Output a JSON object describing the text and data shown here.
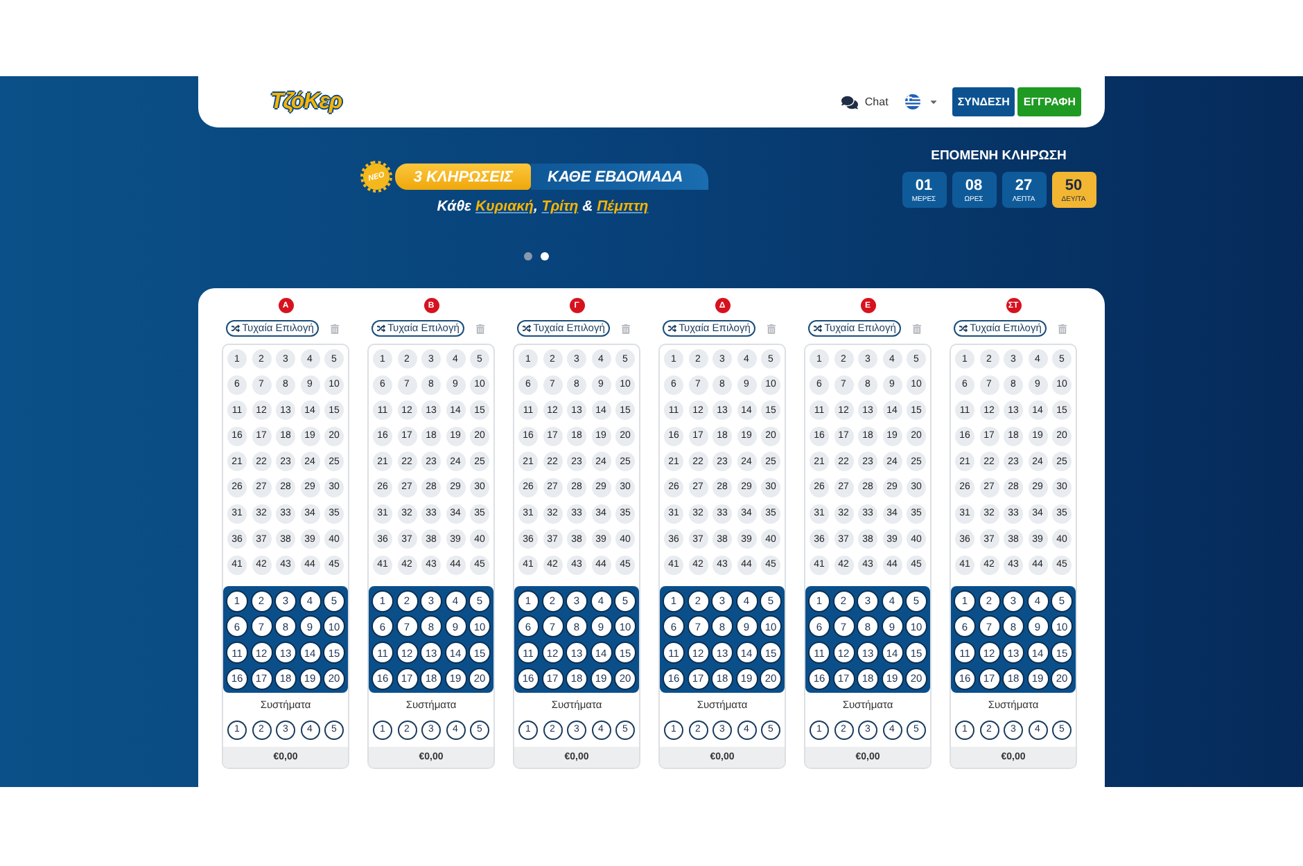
{
  "header": {
    "logo": "ΤζόΚερ",
    "chat_link": "Chat",
    "buttons": [
      {
        "label": "ΣΥΝΔΕΣΗ",
        "kind": "login"
      },
      {
        "label": "ΕΓΓΡΑΦΗ",
        "kind": "register"
      }
    ]
  },
  "banner": {
    "badge": "ΝΕΟ",
    "highlight": "3 ΚΛΗΡΩΣΕΙΣ",
    "headline": "ΚΑΘΕ ΕΒΔΟΜΑΔΑ",
    "subtitle": "Κάθε **Κυριακή**, **Τρίτη** & **Πέμπτη**",
    "dots": [
      {
        "selected": false
      },
      {
        "selected": true
      }
    ]
  },
  "countdown": {
    "title": "ΕΠΟΜΕΝΗ ΚΛΗΡΩΣΗ",
    "units": [
      {
        "value": "01",
        "label": "ΜΕΡΕΣ",
        "highlighted": false
      },
      {
        "value": "08",
        "label": "ΩΡΕΣ",
        "highlighted": false
      },
      {
        "value": "27",
        "label": "ΛΕΠΤΑ",
        "highlighted": false
      },
      {
        "value": "50",
        "label": "ΔΕΥ/ΤΑ",
        "highlighted": true
      }
    ]
  },
  "coupons": [
    {
      "label": "Α",
      "random_pick": "Τυχαία Επιλογή",
      "numbers": [
        "1",
        "2",
        "3",
        "4",
        "5",
        "6",
        "7",
        "8",
        "9",
        "10",
        "11",
        "12",
        "13",
        "14",
        "15",
        "16",
        "17",
        "18",
        "19",
        "20",
        "21",
        "22",
        "23",
        "24",
        "25",
        "26",
        "27",
        "28",
        "29",
        "30",
        "31",
        "32",
        "33",
        "34",
        "35",
        "36",
        "37",
        "38",
        "39",
        "40",
        "41",
        "42",
        "43",
        "44",
        "45"
      ],
      "joker_numbers": [
        "1",
        "2",
        "3",
        "4",
        "5",
        "6",
        "7",
        "8",
        "9",
        "10",
        "11",
        "12",
        "13",
        "14",
        "15",
        "16",
        "17",
        "18",
        "19",
        "20"
      ],
      "systems_title": "Συστήματα",
      "systems": [
        "1",
        "2",
        "3",
        "4",
        "5"
      ],
      "price": "€0,00"
    },
    {
      "label": "Β",
      "random_pick": "Τυχαία Επιλογή",
      "numbers": [
        "1",
        "2",
        "3",
        "4",
        "5",
        "6",
        "7",
        "8",
        "9",
        "10",
        "11",
        "12",
        "13",
        "14",
        "15",
        "16",
        "17",
        "18",
        "19",
        "20",
        "21",
        "22",
        "23",
        "24",
        "25",
        "26",
        "27",
        "28",
        "29",
        "30",
        "31",
        "32",
        "33",
        "34",
        "35",
        "36",
        "37",
        "38",
        "39",
        "40",
        "41",
        "42",
        "43",
        "44",
        "45"
      ],
      "joker_numbers": [
        "1",
        "2",
        "3",
        "4",
        "5",
        "6",
        "7",
        "8",
        "9",
        "10",
        "11",
        "12",
        "13",
        "14",
        "15",
        "16",
        "17",
        "18",
        "19",
        "20"
      ],
      "systems_title": "Συστήματα",
      "systems": [
        "1",
        "2",
        "3",
        "4",
        "5"
      ],
      "price": "€0,00"
    },
    {
      "label": "Γ",
      "random_pick": "Τυχαία Επιλογή",
      "numbers": [
        "1",
        "2",
        "3",
        "4",
        "5",
        "6",
        "7",
        "8",
        "9",
        "10",
        "11",
        "12",
        "13",
        "14",
        "15",
        "16",
        "17",
        "18",
        "19",
        "20",
        "21",
        "22",
        "23",
        "24",
        "25",
        "26",
        "27",
        "28",
        "29",
        "30",
        "31",
        "32",
        "33",
        "34",
        "35",
        "36",
        "37",
        "38",
        "39",
        "40",
        "41",
        "42",
        "43",
        "44",
        "45"
      ],
      "joker_numbers": [
        "1",
        "2",
        "3",
        "4",
        "5",
        "6",
        "7",
        "8",
        "9",
        "10",
        "11",
        "12",
        "13",
        "14",
        "15",
        "16",
        "17",
        "18",
        "19",
        "20"
      ],
      "systems_title": "Συστήματα",
      "systems": [
        "1",
        "2",
        "3",
        "4",
        "5"
      ],
      "price": "€0,00"
    },
    {
      "label": "Δ",
      "random_pick": "Τυχαία Επιλογή",
      "numbers": [
        "1",
        "2",
        "3",
        "4",
        "5",
        "6",
        "7",
        "8",
        "9",
        "10",
        "11",
        "12",
        "13",
        "14",
        "15",
        "16",
        "17",
        "18",
        "19",
        "20",
        "21",
        "22",
        "23",
        "24",
        "25",
        "26",
        "27",
        "28",
        "29",
        "30",
        "31",
        "32",
        "33",
        "34",
        "35",
        "36",
        "37",
        "38",
        "39",
        "40",
        "41",
        "42",
        "43",
        "44",
        "45"
      ],
      "joker_numbers": [
        "1",
        "2",
        "3",
        "4",
        "5",
        "6",
        "7",
        "8",
        "9",
        "10",
        "11",
        "12",
        "13",
        "14",
        "15",
        "16",
        "17",
        "18",
        "19",
        "20"
      ],
      "systems_title": "Συστήματα",
      "systems": [
        "1",
        "2",
        "3",
        "4",
        "5"
      ],
      "price": "€0,00"
    },
    {
      "label": "Ε",
      "random_pick": "Τυχαία Επιλογή",
      "numbers": [
        "1",
        "2",
        "3",
        "4",
        "5",
        "6",
        "7",
        "8",
        "9",
        "10",
        "11",
        "12",
        "13",
        "14",
        "15",
        "16",
        "17",
        "18",
        "19",
        "20",
        "21",
        "22",
        "23",
        "24",
        "25",
        "26",
        "27",
        "28",
        "29",
        "30",
        "31",
        "32",
        "33",
        "34",
        "35",
        "36",
        "37",
        "38",
        "39",
        "40",
        "41",
        "42",
        "43",
        "44",
        "45"
      ],
      "joker_numbers": [
        "1",
        "2",
        "3",
        "4",
        "5",
        "6",
        "7",
        "8",
        "9",
        "10",
        "11",
        "12",
        "13",
        "14",
        "15",
        "16",
        "17",
        "18",
        "19",
        "20"
      ],
      "systems_title": "Συστήματα",
      "systems": [
        "1",
        "2",
        "3",
        "4",
        "5"
      ],
      "price": "€0,00"
    },
    {
      "label": "ΣΤ",
      "random_pick": "Τυχαία Επιλογή",
      "numbers": [
        "1",
        "2",
        "3",
        "4",
        "5",
        "6",
        "7",
        "8",
        "9",
        "10",
        "11",
        "12",
        "13",
        "14",
        "15",
        "16",
        "17",
        "18",
        "19",
        "20",
        "21",
        "22",
        "23",
        "24",
        "25",
        "26",
        "27",
        "28",
        "29",
        "30",
        "31",
        "32",
        "33",
        "34",
        "35",
        "36",
        "37",
        "38",
        "39",
        "40",
        "41",
        "42",
        "43",
        "44",
        "45"
      ],
      "joker_numbers": [
        "1",
        "2",
        "3",
        "4",
        "5",
        "6",
        "7",
        "8",
        "9",
        "10",
        "11",
        "12",
        "13",
        "14",
        "15",
        "16",
        "17",
        "18",
        "19",
        "20"
      ],
      "systems_title": "Συστήματα",
      "systems": [
        "1",
        "2",
        "3",
        "4",
        "5"
      ],
      "price": "€0,00"
    }
  ]
}
